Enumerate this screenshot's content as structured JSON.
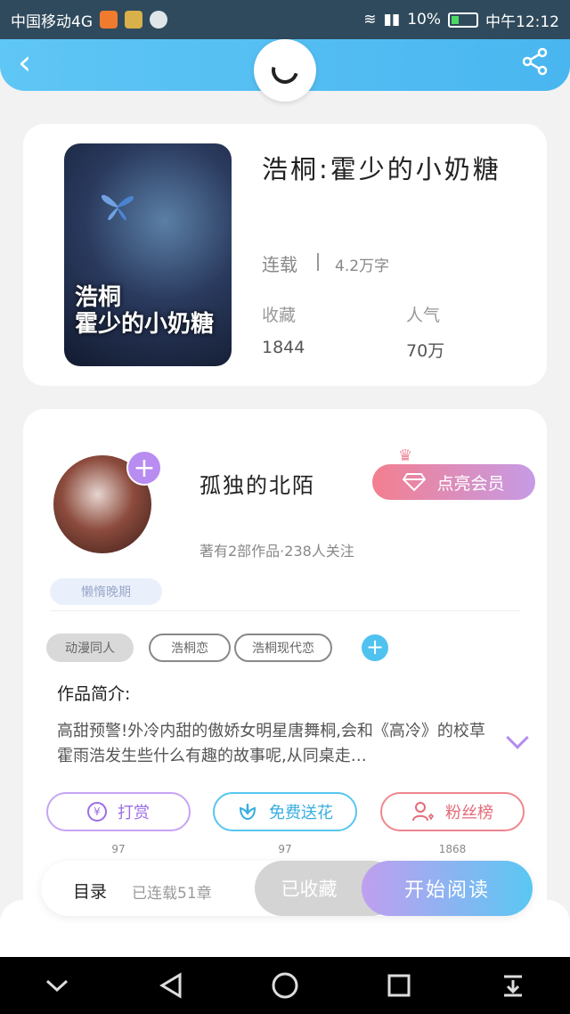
{
  "status_bar": {
    "carrier": "中国移动4G",
    "battery": "10%",
    "time": "中午12:12"
  },
  "header": {
    "back_icon": "chevron-left-icon",
    "share_icon": "share-icon",
    "center_icon": "loading-spinner-icon"
  },
  "book": {
    "cover_title_line1": "浩桐",
    "cover_title_line2": "霍少的小奶糖",
    "title": "浩桐:霍少的小奶糖",
    "status": "连载",
    "words": "4.2万字",
    "favorites_label": "收藏",
    "popularity_label": "人气",
    "favorites_value": "1844",
    "popularity_value": "70万"
  },
  "author": {
    "name": "孤独的北陌",
    "meta": "著有2部作品·238人关注",
    "vip_button": "点亮会员",
    "badge": "懒惰晚期"
  },
  "tags": [
    "动漫同人",
    "浩桐恋",
    "浩桐现代恋"
  ],
  "intro": {
    "title": "作品简介:",
    "text": "高甜预警!外冷内甜的傲娇女明星唐舞桐,会和《高冷》的校草霍雨浩发生些什么有趣的故事呢,从同桌走…"
  },
  "actions": [
    {
      "label": "打赏",
      "count": "97",
      "icon": "yuan-icon"
    },
    {
      "label": "免费送花",
      "count": "97",
      "icon": "flower-icon"
    },
    {
      "label": "粉丝榜",
      "count": "1868",
      "icon": "user-heart-icon"
    }
  ],
  "bottom_bar": {
    "toc": "目录",
    "serial": "已连载51章",
    "collected": "已收藏",
    "start_reading": "开始阅读"
  },
  "colors": {
    "header_blue": "#49b6f0",
    "purple": "#b88cf0",
    "pink": "#f37f8f",
    "cyan": "#58c6ef"
  }
}
